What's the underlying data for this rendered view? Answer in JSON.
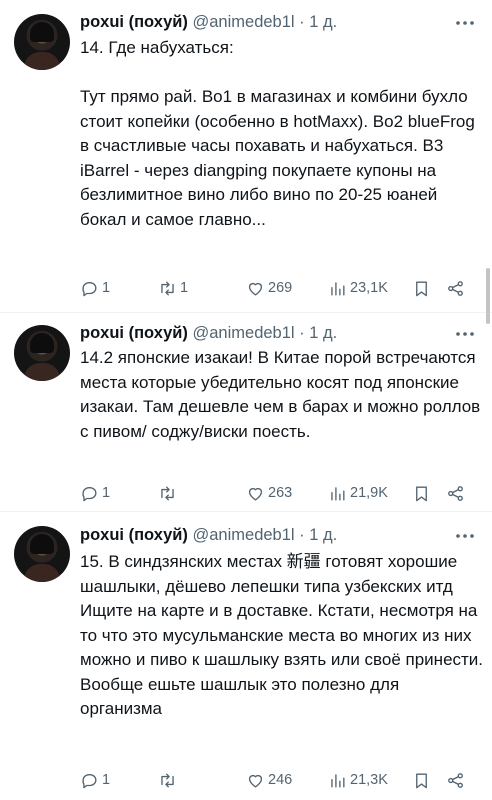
{
  "tweets": [
    {
      "name": "poxui (похуй)",
      "handle": "@animedeb1l",
      "dot": "·",
      "time": "1 д.",
      "text": "14. Где набухаться:\n\nТут прямо рай. Во1 в магазинах и комбини бухло стоит копейки (особенно в hotMaxx). Во2 blueFrog в счастливые часы похавать и набухаться. В3 iBarrel - через diangping покупаете купоны на безлимитное вино либо вино по 20-25 юаней бокал и самое главно...",
      "replies": "1",
      "retweets": "1",
      "likes": "269",
      "views": "23,1K"
    },
    {
      "name": "poxui (похуй)",
      "handle": "@animedeb1l",
      "dot": "·",
      "time": "1 д.",
      "text": "14.2 японские изакаи! В Китае порой встречаются места которые убедительно косят под японские изакаи. Там дешевле чем в барах и можно роллов с пивом/ соджу/виски поесть.",
      "replies": "1",
      "retweets": "",
      "likes": "263",
      "views": "21,9K"
    },
    {
      "name": "poxui (похуй)",
      "handle": "@animedeb1l",
      "dot": "·",
      "time": "1 д.",
      "text": "15. В синдзянских местах 新疆 готовят хорошие шашлыки, дёшево лепешки типа узбекских итд Ищите на карте и в доставке. Кстати, несмотря на то что это мусульманские места во многих из них можно и пиво к шашлыку взять или своё принести. Вообще ешьте шашлык это полезно для организма",
      "replies": "1",
      "retweets": "",
      "likes": "246",
      "views": "21,3K"
    }
  ],
  "icons": {
    "reply": "reply-icon",
    "retweet": "retweet-icon",
    "like": "heart-icon",
    "views": "views-icon",
    "bookmark": "bookmark-icon",
    "share": "share-icon",
    "more": "more-icon"
  },
  "colors": {
    "text": "#0f1419",
    "secondary": "#536471",
    "divider": "#eff3f4"
  }
}
